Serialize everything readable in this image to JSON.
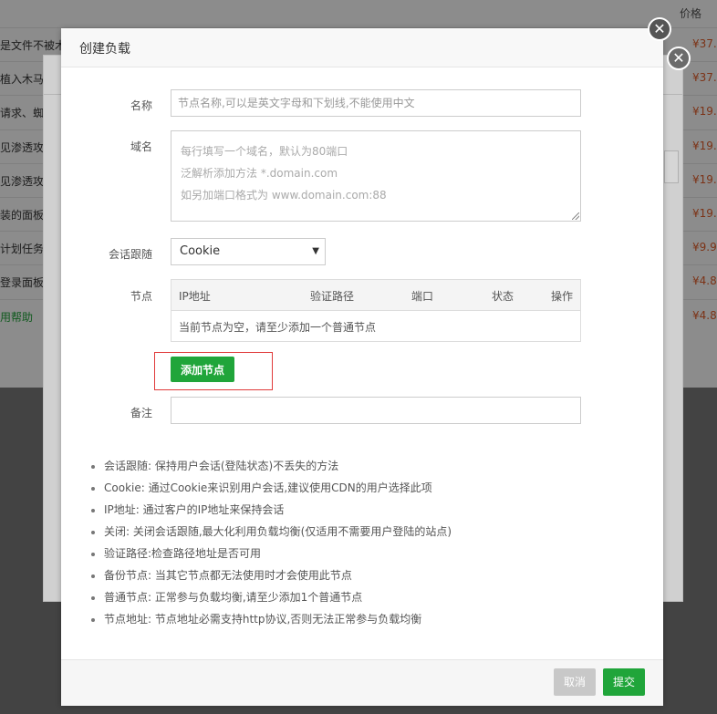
{
  "background": {
    "header_price": "价格",
    "rows": [
      {
        "text": "是文件不被木马",
        "price": "¥37.",
        "style": "normal"
      },
      {
        "text": "植入木马",
        "price": "¥37.",
        "style": "normal"
      },
      {
        "text": "请求、蜘",
        "price": "¥19.",
        "style": "normal"
      },
      {
        "text": "见渗透攻击",
        "price": "¥19.",
        "style": "normal"
      },
      {
        "text": "见渗透攻击",
        "price": "¥19.",
        "style": "normal"
      },
      {
        "text": "装的面板,",
        "price": "¥19.",
        "style": "normal"
      },
      {
        "text": "计划任务",
        "price": "¥9.9",
        "style": "normal"
      },
      {
        "text": "登录面板",
        "price": "¥4.8",
        "style": "normal"
      },
      {
        "text": "用帮助",
        "price": "¥4.8",
        "style": "green"
      }
    ]
  },
  "dialog": {
    "title": "创建负载",
    "name": {
      "label": "名称",
      "placeholder": "节点名称,可以是英文字母和下划线,不能使用中文"
    },
    "domain": {
      "label": "域名",
      "placeholder_lines": [
        "每行填写一个域名，默认为80端口",
        "泛解析添加方法 *.domain.com",
        "如另加端口格式为 www.domain.com:88"
      ]
    },
    "session": {
      "label": "会话跟随",
      "value": "Cookie"
    },
    "nodes": {
      "label": "节点",
      "columns": [
        "IP地址",
        "验证路径",
        "端口",
        "状态",
        "操作"
      ],
      "empty_text": "当前节点为空，请至少添加一个普通节点",
      "add_button": "添加节点"
    },
    "note": {
      "label": "备注",
      "value": ""
    },
    "help": [
      "会话跟随: 保持用户会话(登陆状态)不丢失的方法",
      "Cookie: 通过Cookie来识别用户会话,建议使用CDN的用户选择此项",
      "IP地址: 通过客户的IP地址来保持会话",
      "关闭: 关闭会话跟随,最大化利用负载均衡(仅适用不需要用户登陆的站点)",
      "验证路径:检查路径地址是否可用",
      "备份节点: 当其它节点都无法使用时才会使用此节点",
      "普通节点: 正常参与负载均衡,请至少添加1个普通节点",
      "节点地址: 节点地址必需支持http协议,否则无法正常参与负载均衡"
    ],
    "footer": {
      "cancel": "取消",
      "submit": "提交"
    }
  },
  "icons": {
    "close": "close-icon",
    "select_arrow": "chevron-down-icon"
  },
  "colors": {
    "primary": "#20a53a",
    "highlight_border": "#e03a3a",
    "price": "#e25e2a"
  }
}
